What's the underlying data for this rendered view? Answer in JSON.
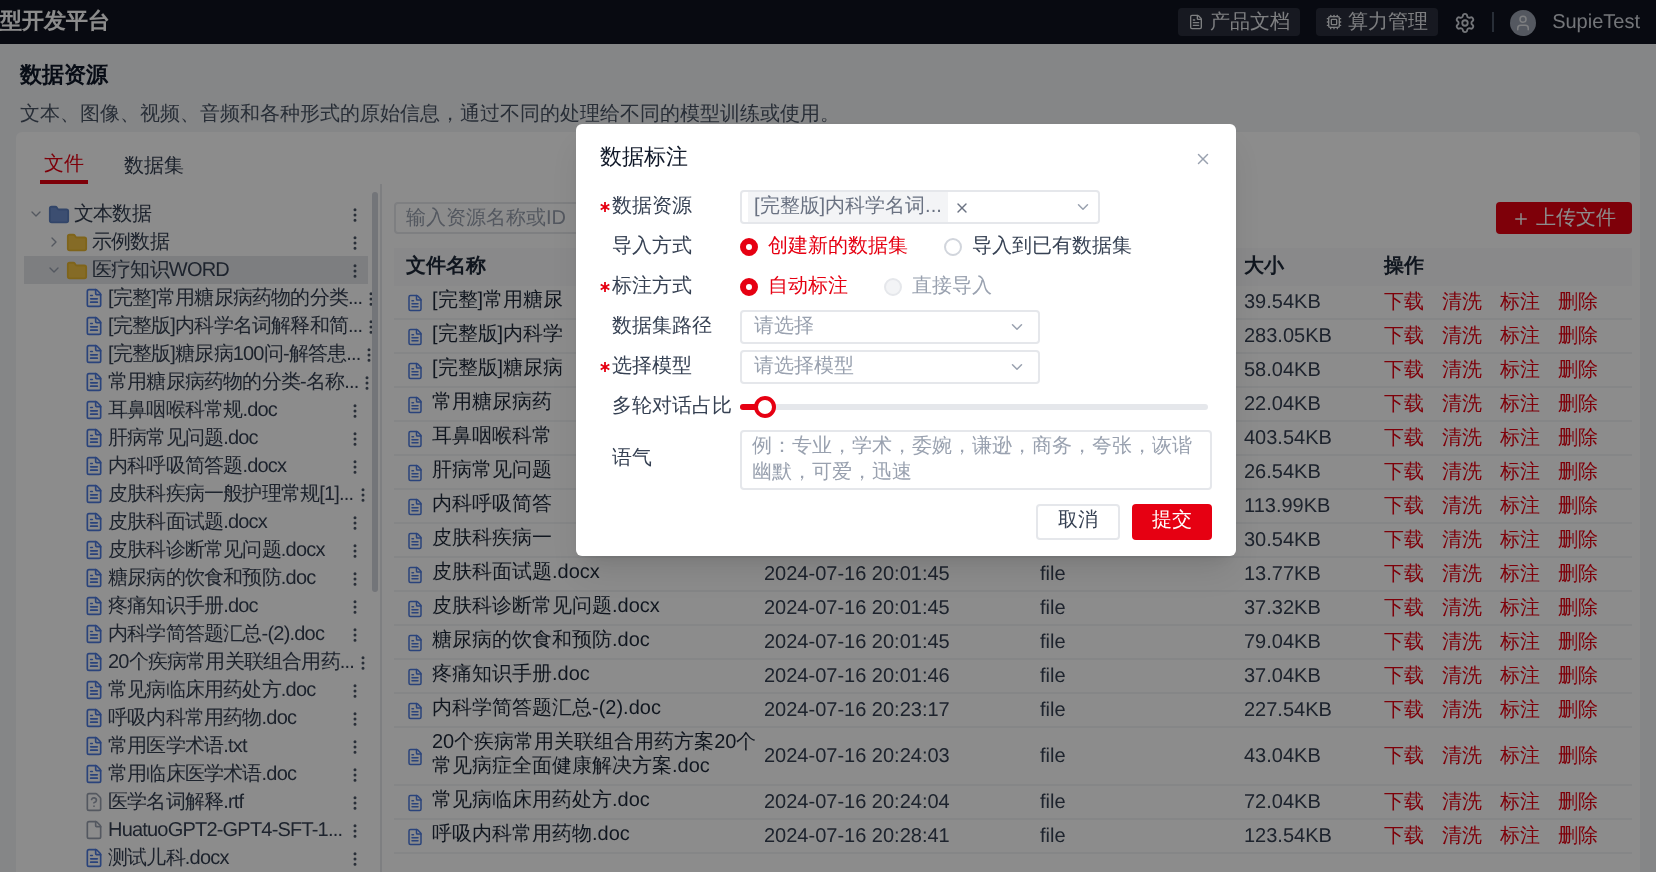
{
  "top_bar": {
    "title": "型开发平台",
    "buttons": [
      {
        "label": "产品文档",
        "kind": "doc"
      },
      {
        "label": "算力管理",
        "kind": "chip"
      }
    ],
    "user": "SupieTest"
  },
  "header": {
    "title": "数据资源",
    "description": "文本、图像、视频、音频和各种形式的原始信息，通过不同的处理给不同的模型训练或使用。"
  },
  "tabs": [
    {
      "label": "文件",
      "selected": true
    },
    {
      "label": "数据集",
      "selected": false
    }
  ],
  "tree": [
    {
      "label": "文本数据",
      "kind": "library",
      "expanded": true,
      "selected": false,
      "children": [
        {
          "label": "示例数据",
          "kind": "folder",
          "expanded": false,
          "selected": false
        },
        {
          "label": "医疗知识WORD",
          "kind": "folder",
          "expanded": true,
          "selected": true,
          "children": [
            {
              "label": "[完整]常用糖尿病药物的分类...",
              "kind": "doc",
              "selected": false
            },
            {
              "label": "[完整版]内科学名词解释和简...",
              "kind": "doc",
              "selected": false
            },
            {
              "label": "[完整版]糖尿病100问-解答患...",
              "kind": "doc",
              "selected": false
            },
            {
              "label": "常用糖尿病药物的分类-名称...",
              "kind": "doc",
              "selected": false
            },
            {
              "label": "耳鼻咽喉科常规.doc",
              "kind": "doc",
              "selected": false
            },
            {
              "label": "肝病常见问题.doc",
              "kind": "doc",
              "selected": false
            },
            {
              "label": "内科呼吸简答题.docx",
              "kind": "doc",
              "selected": false
            },
            {
              "label": "皮肤科疾病一般护理常规[1]...",
              "kind": "doc",
              "selected": false
            },
            {
              "label": "皮肤科面试题.docx",
              "kind": "doc",
              "selected": false
            },
            {
              "label": "皮肤科诊断常见问题.docx",
              "kind": "doc",
              "selected": false
            },
            {
              "label": "糖尿病的饮食和预防.doc",
              "kind": "doc",
              "selected": false
            },
            {
              "label": "疼痛知识手册.doc",
              "kind": "doc",
              "selected": false
            },
            {
              "label": "内科学简答题汇总-(2).doc",
              "kind": "doc",
              "selected": false
            },
            {
              "label": "20个疾病常用关联组合用药...",
              "kind": "doc",
              "selected": false
            },
            {
              "label": "常见病临床用药处方.doc",
              "kind": "doc",
              "selected": false
            },
            {
              "label": "呼吸内科常用药物.doc",
              "kind": "doc",
              "selected": false
            },
            {
              "label": "常用医学术语.txt",
              "kind": "doc",
              "selected": false
            },
            {
              "label": "常用临床医学术语.doc",
              "kind": "doc",
              "selected": false
            },
            {
              "label": "医学名词解释.rtf",
              "kind": "unknown",
              "selected": false
            },
            {
              "label": "HuatuoGPT2-GPT4-SFT-1...",
              "kind": "file",
              "selected": false
            },
            {
              "label": "测试儿科.docx",
              "kind": "doc",
              "selected": false
            }
          ]
        }
      ]
    }
  ],
  "search": {
    "placeholder": "输入资源名称或ID"
  },
  "upload_button": "上传文件",
  "table": {
    "columns": {
      "name": "文件名称",
      "size": "大小",
      "actions": "操作"
    },
    "rows": [
      {
        "name": "[完整]常用糖尿",
        "size": "39.54KB",
        "actions": [
          "下载",
          "清洗",
          "标注",
          "删除"
        ]
      },
      {
        "name": "[完整版]内科学",
        "size": "283.05KB",
        "actions": [
          "下载",
          "清洗",
          "标注",
          "删除"
        ]
      },
      {
        "name": "[完整版]糖尿病",
        "size": "58.04KB",
        "actions": [
          "下载",
          "清洗",
          "标注",
          "删除"
        ]
      },
      {
        "name": "常用糖尿病药",
        "size": "22.04KB",
        "actions": [
          "下载",
          "清洗",
          "标注",
          "删除"
        ]
      },
      {
        "name": "耳鼻咽喉科常",
        "size": "403.54KB",
        "actions": [
          "下载",
          "清洗",
          "标注",
          "删除"
        ]
      },
      {
        "name": "肝病常见问题",
        "size": "26.54KB",
        "actions": [
          "下载",
          "清洗",
          "标注",
          "删除"
        ]
      },
      {
        "name": "内科呼吸简答",
        "size": "113.99KB",
        "actions": [
          "下载",
          "清洗",
          "标注",
          "删除"
        ]
      },
      {
        "name": "皮肤科疾病一",
        "size": "30.54KB",
        "actions": [
          "下载",
          "清洗",
          "标注",
          "删除"
        ]
      },
      {
        "name": "皮肤科面试题.docx",
        "time": "2024-07-16 20:01:45",
        "type": "file",
        "size": "13.77KB",
        "actions": [
          "下载",
          "清洗",
          "标注",
          "删除"
        ]
      },
      {
        "name": "皮肤科诊断常见问题.docx",
        "time": "2024-07-16 20:01:45",
        "type": "file",
        "size": "37.32KB",
        "actions": [
          "下载",
          "清洗",
          "标注",
          "删除"
        ]
      },
      {
        "name": "糖尿病的饮食和预防.doc",
        "time": "2024-07-16 20:01:45",
        "type": "file",
        "size": "79.04KB",
        "actions": [
          "下载",
          "清洗",
          "标注",
          "删除"
        ]
      },
      {
        "name": "疼痛知识手册.doc",
        "time": "2024-07-16 20:01:46",
        "type": "file",
        "size": "37.04KB",
        "actions": [
          "下载",
          "清洗",
          "标注",
          "删除"
        ]
      },
      {
        "name": "内科学简答题汇总-(2).doc",
        "time": "2024-07-16 20:23:17",
        "type": "file",
        "size": "227.54KB",
        "actions": [
          "下载",
          "清洗",
          "标注",
          "删除"
        ]
      },
      {
        "name": "20个疾病常用关联组合用药方案20个常见病症全面健康解决方案.doc",
        "time": "2024-07-16 20:24:03",
        "type": "file",
        "size": "43.04KB",
        "actions": [
          "下载",
          "清洗",
          "标注",
          "删除"
        ]
      },
      {
        "name": "常见病临床用药处方.doc",
        "time": "2024-07-16 20:24:04",
        "type": "file",
        "size": "72.04KB",
        "actions": [
          "下载",
          "清洗",
          "标注",
          "删除"
        ]
      },
      {
        "name": "呼吸内科常用药物.doc",
        "time": "2024-07-16 20:28:41",
        "type": "file",
        "size": "123.54KB",
        "actions": [
          "下载",
          "清洗",
          "标注",
          "删除"
        ]
      }
    ]
  },
  "modal": {
    "title": "数据标注",
    "fields": [
      {
        "kind": "tag_select",
        "label": "数据资源",
        "required": true,
        "tag": "[完整版]内科学名词..."
      },
      {
        "kind": "radio",
        "label": "导入方式",
        "required": false,
        "options": [
          {
            "label": "创建新的数据集",
            "selected": true,
            "disabled": false
          },
          {
            "label": "导入到已有数据集",
            "selected": false,
            "disabled": false
          }
        ]
      },
      {
        "kind": "radio",
        "label": "标注方式",
        "required": true,
        "options": [
          {
            "label": "自动标注",
            "selected": true,
            "disabled": false
          },
          {
            "label": "直接导入",
            "selected": false,
            "disabled": true
          }
        ]
      },
      {
        "kind": "select",
        "label": "数据集路径",
        "required": false,
        "placeholder": "请选择"
      },
      {
        "kind": "select",
        "label": "选择模型",
        "required": true,
        "placeholder": "请选择模型"
      },
      {
        "kind": "slider",
        "label": "多轮对话占比",
        "required": false,
        "level": 0.05
      },
      {
        "kind": "input",
        "label": "语气",
        "required": false,
        "placeholder": "例：专业，学术，委婉，谦逊，商务，夸张，诙谐幽默，可爱，迅速"
      }
    ],
    "buttons": [
      {
        "label": "取消",
        "kind": "secondary"
      },
      {
        "label": "提交",
        "kind": "primary"
      }
    ]
  }
}
